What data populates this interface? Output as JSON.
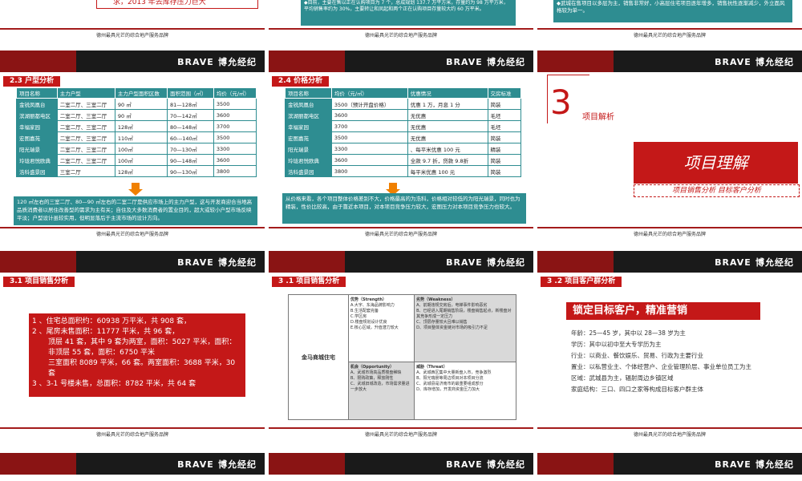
{
  "footer_text": "德州最具光芒的综合地产服务品牌",
  "logo": {
    "brand": "BRAVE",
    "name": "博允经纪"
  },
  "top_row": {
    "s1": "求，2013 年去库存压力巨大",
    "s2": "◆目前，主要在售以正在认购项目为 7 个，总成规划 137.7 万平方米，存量约为 98 万平方米，平均销售率约为 30%，主要转让和凤起和两个正在认购项目存量较大约 60 万平米。",
    "s3": "◆武城在售项目以多层为主，销售非常好，小高层住宅项目逐年增多，销售抗性逐渐减少，外立面风格较为单一。"
  },
  "slide4": {
    "label": "2.3 户型分析",
    "headers": [
      "项目名称",
      "主力户型",
      "主力户型面积区数",
      "面积范围（㎡）",
      "均价（元/㎡）"
    ],
    "rows": [
      [
        "金锐凤凰台",
        "二室二厅、三室二厅",
        "90 ㎡",
        "81—128㎡",
        "3500"
      ],
      [
        "滨湖丽都电区",
        "二室二厅、三室二厅",
        "90 ㎡",
        "70—142㎡",
        "3600"
      ],
      [
        "幸福家园",
        "二室二厅、三室二厅",
        "128㎡",
        "80—148㎡",
        "3700"
      ],
      [
        "宏图嘉苑",
        "二室二厅、三室二厅",
        "110㎡",
        "60---140㎡",
        "3500"
      ],
      [
        "阳光瑞景",
        "二室二厅、三室二厅",
        "100㎡",
        "70—130㎡",
        "3300"
      ],
      [
        "玲珑君悦欧典",
        "二室二厅、三室二厅",
        "100㎡",
        "90—148㎡",
        "3600"
      ],
      [
        "浩科盛景园",
        "三室二厅",
        "128㎡",
        "90—130㎡",
        "3800"
      ]
    ],
    "note": "120 ㎡左右的三室二厅、80—90 ㎡左右的二室二厅是供应市场上的主力户型，这与开发商迎合当地高品质消费者以居住改善型的需求为主有关；自住及大多数消费者的置业目的，超大或较小户型市场反映平淡；户型设计虽较实用，但明显落后于主流市场的设计方向。"
  },
  "slide5": {
    "label": "2.4 价格分析",
    "headers": [
      "项目名称",
      "均价（元/㎡）",
      "优惠情况",
      "交房标准"
    ],
    "rows": [
      [
        "金锐凤凰台",
        "3500（预计开盘价格）",
        "优惠 1 万，月息 1 分",
        "简装"
      ],
      [
        "滨湖丽都电区",
        "3600",
        "无优惠",
        "毛坯"
      ],
      [
        "幸福家园",
        "3700",
        "无优惠",
        "毛坯"
      ],
      [
        "宏图嘉苑",
        "3500",
        "无优惠",
        "简装"
      ],
      [
        "阳光瑞景",
        "3300",
        "、每平米优惠 100 元",
        "精装"
      ],
      [
        "玲珑君悦欧典",
        "3600",
        "全款 9.7 折，贷款 9.8折",
        "简装"
      ],
      [
        "浩科盛景园",
        "3800",
        "每平米优惠 100 元",
        "简装"
      ]
    ],
    "note": "从价格来看，各个项目整体价格差别不大，价格最高的为浩科，价格相对较低的为阳光瑞景，同时也为精装，性价比较高，由于靠近本项目，对本项目竞争压力较大，宏图压力对本项目竞争压力也较大。"
  },
  "slide6": {
    "num": "3",
    "num_label": "项目解析",
    "title": "项目理解",
    "subtitle": "项目销售分析 目标客户分析"
  },
  "slide7": {
    "label": "3.1 项目销售分析",
    "lines": [
      "1 、住宅总面积约：60938 万平米，共 908 套，",
      "2 、尾房未售面积：11777 平米，共 96 套，",
      "顶层 41 套，其中 9 套为两室，面积：5027 平米，面积：非顶层 55 套，面积：6750 平米",
      "三室面积 8089 平米，66 套。两室面积：3688 平米，30 套",
      "3 、3-1 号楼未售，总面积：8782 平米，共 64 套"
    ]
  },
  "slide8": {
    "label": "3 .1 项目销售分析",
    "left": "金马商城住宅",
    "s_title": "优势（Strength）",
    "s_items": [
      "A.大宇、东海品牌影响力",
      "B.生活配套完备",
      "C.学区房",
      "D.楼盘规划设计优良",
      "E.核心区域，升值潜力较大"
    ],
    "w_title": "劣势（Weakness）",
    "w_items": [
      "A、前期违规交房后，电梯事件影响恶劣",
      "B、已经进入尾期销售阶段，楼盘销售起点，新楼盘对其竞争形成一定压力",
      "C、顶层存量较大且难以销售",
      "D、项目整体资金链对市场的吸引力不足"
    ],
    "o_title": "机会（Opportunity）",
    "o_items": [
      "A、武城市场高品质楼盘稀缺",
      "B、限购政策，释放刚性",
      "C、武城旧城改造，市场需求量进一步放大"
    ],
    "t_title": "威胁（Threat）",
    "t_items": [
      "A、武城西区集中大量新盘入市，竞争激烈",
      "B、阳光瑞景等周边项目对本项目分流",
      "C、武城县是济南市的最重要组成部分",
      "D、库存增加，开发商资金压力加大"
    ]
  },
  "slide9": {
    "label": "3 .2 项目客户群分析",
    "banner": "锁定目标客户，精准营销",
    "lines": [
      "年龄：25—45 岁，其中以 28—38 岁为主",
      "学历：其中以初中至大专学历为主",
      "行业：以商业、餐饮娱乐、贸易、行政为主要行业",
      "置业：以私营业主、个体经营户、企业管理阶层、事业单位员工为主",
      "区域：武城县为主，辐射周边乡镇区域",
      "家庭结构：三口、四口之家等构成目标客户群主体"
    ]
  }
}
